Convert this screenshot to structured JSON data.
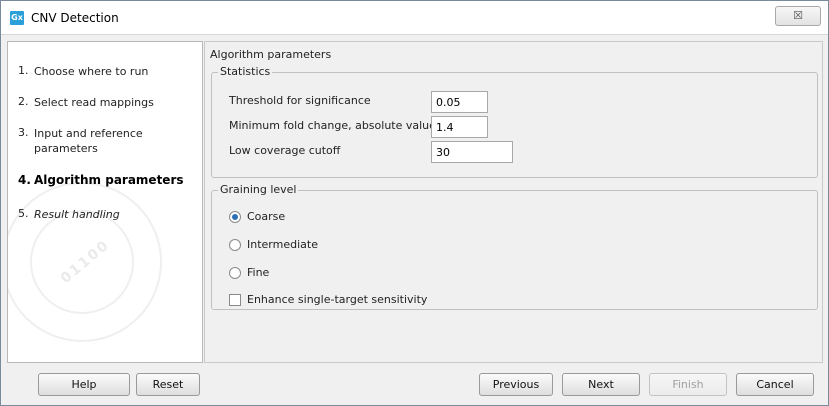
{
  "window": {
    "title": "CNV Detection",
    "app_icon_text": "Gx",
    "close_glyph": "☒"
  },
  "steps": [
    {
      "num": "1.",
      "label": "Choose where to run",
      "state": "done"
    },
    {
      "num": "2.",
      "label": "Select read mappings",
      "state": "done"
    },
    {
      "num": "3.",
      "label": "Input and reference parameters",
      "state": "done"
    },
    {
      "num": "4.",
      "label": "Algorithm parameters",
      "state": "current"
    },
    {
      "num": "5.",
      "label": "Result handling",
      "state": "future"
    }
  ],
  "panel": {
    "title": "Algorithm parameters",
    "statistics": {
      "legend": "Statistics",
      "fields": [
        {
          "label": "Threshold for significance",
          "value": "0.05"
        },
        {
          "label": "Minimum fold change, absolute value",
          "value": "1.4"
        },
        {
          "label": "Low coverage cutoff",
          "value": "30"
        }
      ]
    },
    "graining": {
      "legend": "Graining level",
      "options": [
        {
          "label": "Coarse",
          "checked": true
        },
        {
          "label": "Intermediate",
          "checked": false
        },
        {
          "label": "Fine",
          "checked": false
        }
      ],
      "checkbox": {
        "label": "Enhance single-target sensitivity",
        "checked": false
      }
    }
  },
  "footer": {
    "help": "Help",
    "reset": "Reset",
    "previous": "Previous",
    "next": "Next",
    "finish": "Finish",
    "cancel": "Cancel"
  },
  "watermark_text": "01100"
}
